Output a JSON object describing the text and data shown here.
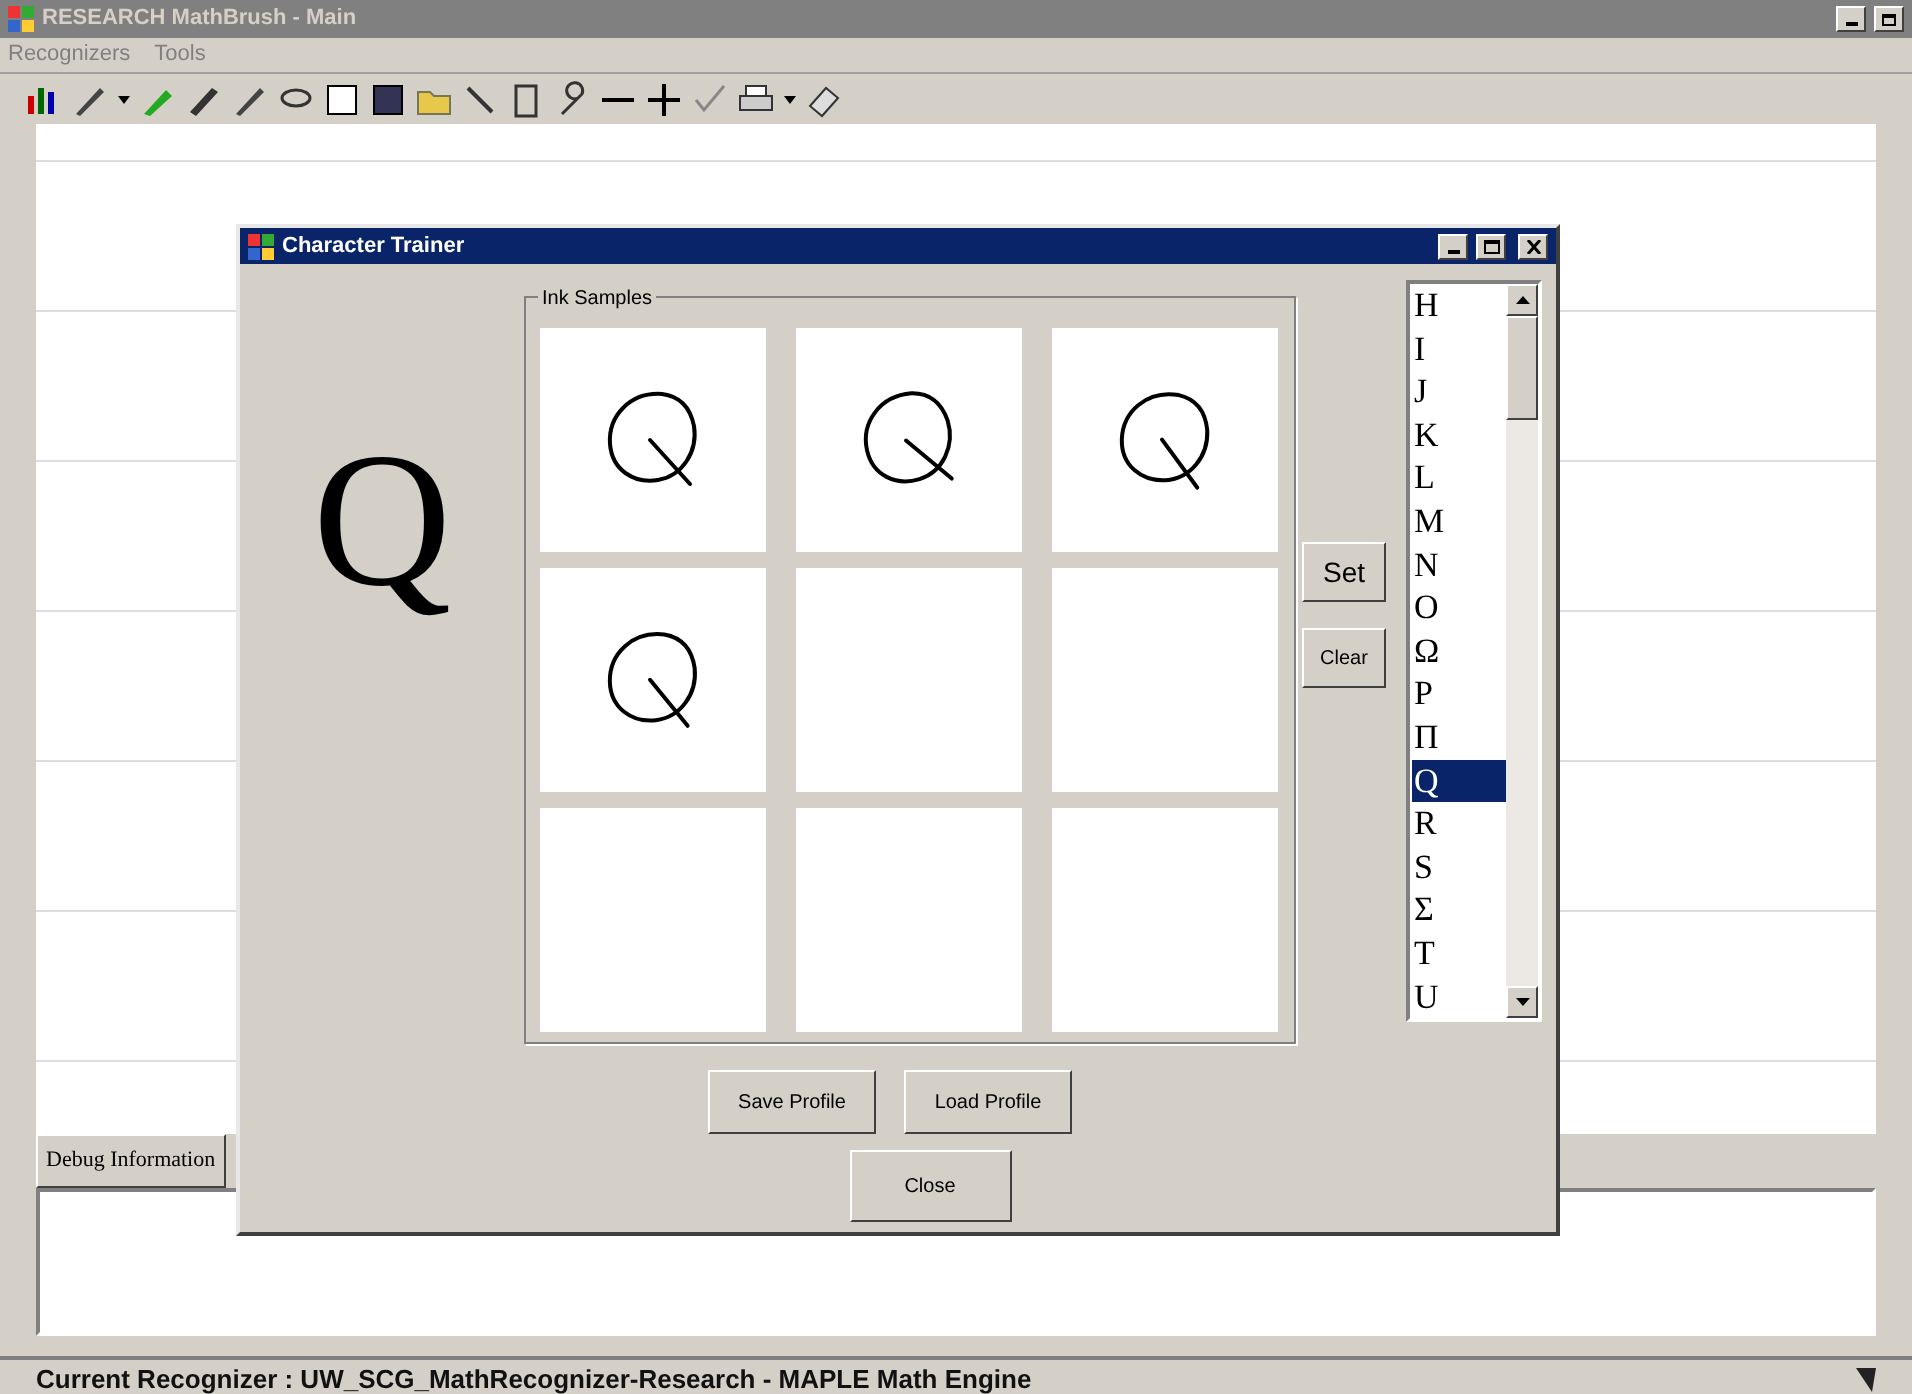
{
  "window": {
    "title": "RESEARCH MathBrush - Main"
  },
  "menu": [
    "Recognizers",
    "Tools"
  ],
  "debug_tab": {
    "label": "Debug Information"
  },
  "status_bar": "Current Recognizer : UW_SCG_MathRecognizer-Research - MAPLE Math Engine",
  "dialog": {
    "title": "Character Trainer",
    "current_symbol": "Q",
    "group_label": "Ink Samples",
    "samples": [
      {
        "filled": true
      },
      {
        "filled": true
      },
      {
        "filled": true
      },
      {
        "filled": true
      },
      {
        "filled": false
      },
      {
        "filled": false
      },
      {
        "filled": false
      },
      {
        "filled": false
      },
      {
        "filled": false
      }
    ],
    "set_button": "Set",
    "clear_button": "Clear",
    "symbols": [
      {
        "label": "H",
        "selected": false
      },
      {
        "label": "I",
        "selected": false
      },
      {
        "label": "J",
        "selected": false
      },
      {
        "label": "K",
        "selected": false
      },
      {
        "label": "L",
        "selected": false
      },
      {
        "label": "M",
        "selected": false
      },
      {
        "label": "N",
        "selected": false
      },
      {
        "label": "O",
        "selected": false
      },
      {
        "label": "Ω",
        "selected": false
      },
      {
        "label": "P",
        "selected": false
      },
      {
        "label": "Π",
        "selected": false
      },
      {
        "label": "Q",
        "selected": true
      },
      {
        "label": "R",
        "selected": false
      },
      {
        "label": "S",
        "selected": false
      },
      {
        "label": "Σ",
        "selected": false
      },
      {
        "label": "T",
        "selected": false
      },
      {
        "label": "U",
        "selected": false
      }
    ],
    "buttons": [
      "Save Profile",
      "Load Profile"
    ],
    "close_button": "Close"
  }
}
